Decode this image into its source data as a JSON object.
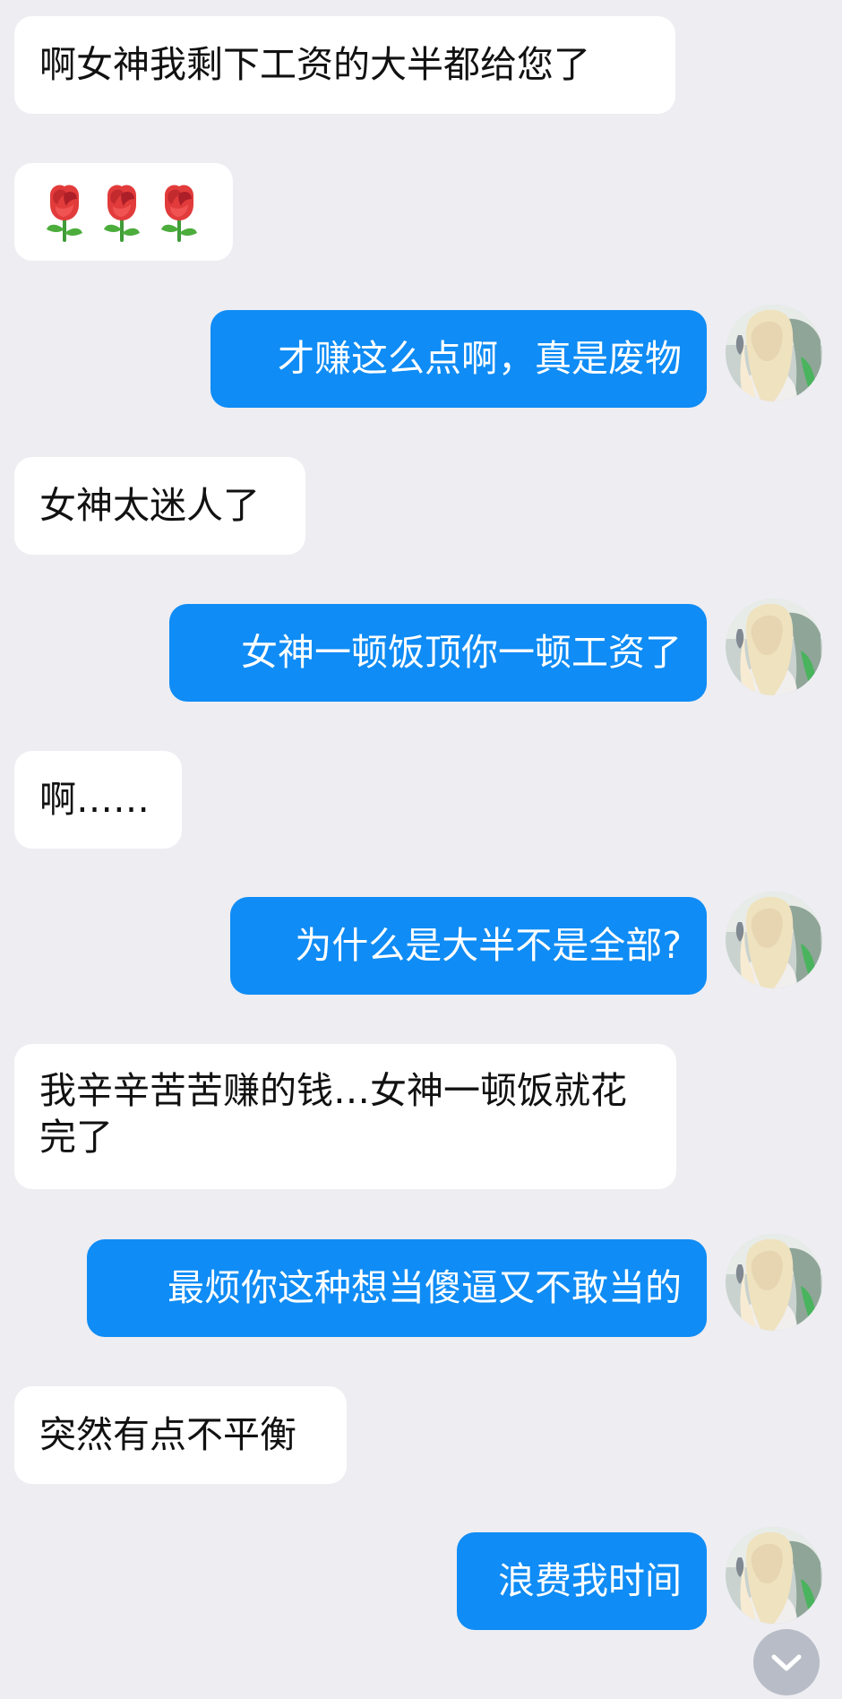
{
  "messages": [
    {
      "side": "in",
      "text": "啊女神我剩下工资的大半都给您了"
    },
    {
      "side": "in",
      "emoji": [
        "rose-icon",
        "rose-icon",
        "rose-icon"
      ]
    },
    {
      "side": "out",
      "text": "才赚这么点啊，真是废物"
    },
    {
      "side": "in",
      "text": "女神太迷人了"
    },
    {
      "side": "out",
      "text": "女神一顿饭顶你一顿工资了"
    },
    {
      "side": "in",
      "text": "啊……"
    },
    {
      "side": "out",
      "text": "为什么是大半不是全部?"
    },
    {
      "side": "in",
      "text": "我辛辛苦苦赚的钱…女神一顿饭就花完了"
    },
    {
      "side": "out",
      "text": "最烦你这种想当傻逼又不敢当的"
    },
    {
      "side": "in",
      "text": "突然有点不平衡"
    },
    {
      "side": "out",
      "text": "浪费我时间"
    }
  ],
  "colors": {
    "background": "#ededf2",
    "incoming_bubble": "#ffffff",
    "outgoing_bubble": "#0f8cf5",
    "outgoing_text": "#ffffff"
  },
  "icons": {
    "avatar": "avatar-blonde-girl",
    "scroll_down": "chevron-down-icon"
  }
}
